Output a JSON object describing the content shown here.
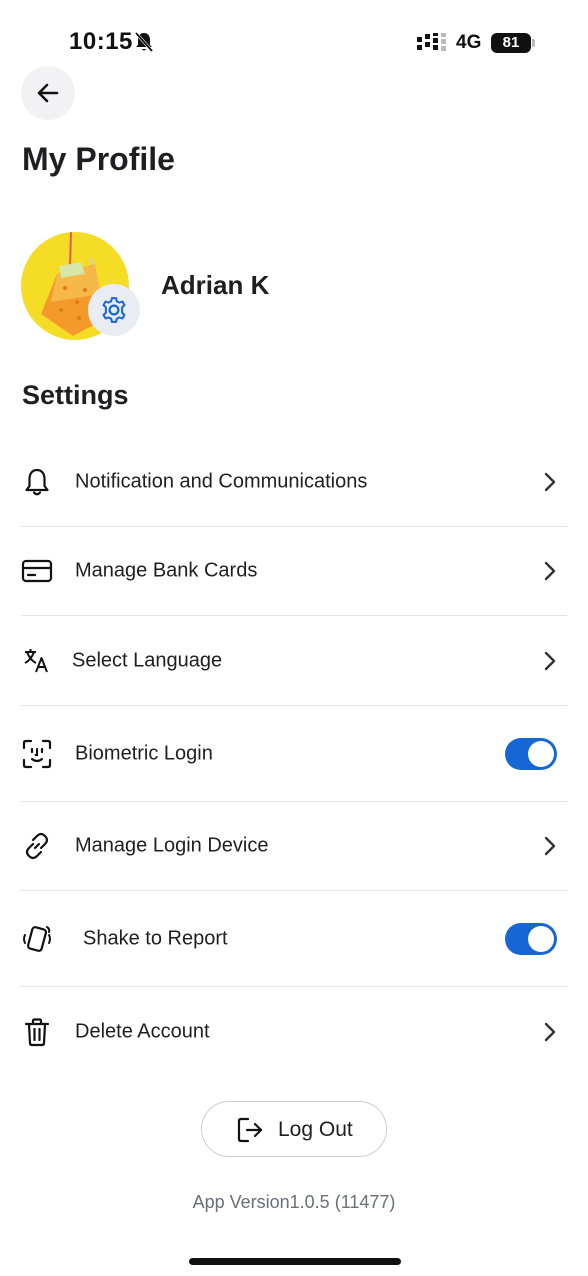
{
  "status_bar": {
    "time": "10:15",
    "network": "4G",
    "battery": "81",
    "icons": [
      "bell-off-icon",
      "signal-icon",
      "battery-icon"
    ]
  },
  "header": {
    "back_icon": "arrow-left-icon",
    "title": "My Profile"
  },
  "profile": {
    "name": "Adrian K",
    "avatar_bg": "#f5dd25",
    "settings_icon": "gear-icon"
  },
  "settings": {
    "heading": "Settings",
    "items": [
      {
        "label": "Notification and Communications",
        "icon": "bell-icon",
        "control": "chevron"
      },
      {
        "label": "Manage Bank Cards",
        "icon": "credit-card-icon",
        "control": "chevron"
      },
      {
        "label": "Select Language",
        "icon": "translate-icon",
        "control": "chevron"
      },
      {
        "label": "Biometric Login",
        "icon": "face-id-icon",
        "control": "toggle",
        "enabled": true
      },
      {
        "label": "Manage Login Device",
        "icon": "link-icon",
        "control": "chevron"
      },
      {
        "label": "Shake to Report",
        "icon": "shake-phone-icon",
        "control": "toggle",
        "enabled": true
      },
      {
        "label": "Delete Account",
        "icon": "trash-icon",
        "control": "chevron"
      }
    ]
  },
  "logout": {
    "label": "Log Out",
    "icon": "logout-icon"
  },
  "footer": {
    "app_version": "App Version1.0.5 (11477)"
  },
  "colors": {
    "accent": "#1766d6",
    "text": "#1f1f23",
    "muted": "#6b6f78",
    "divider": "#e4e4e8"
  }
}
